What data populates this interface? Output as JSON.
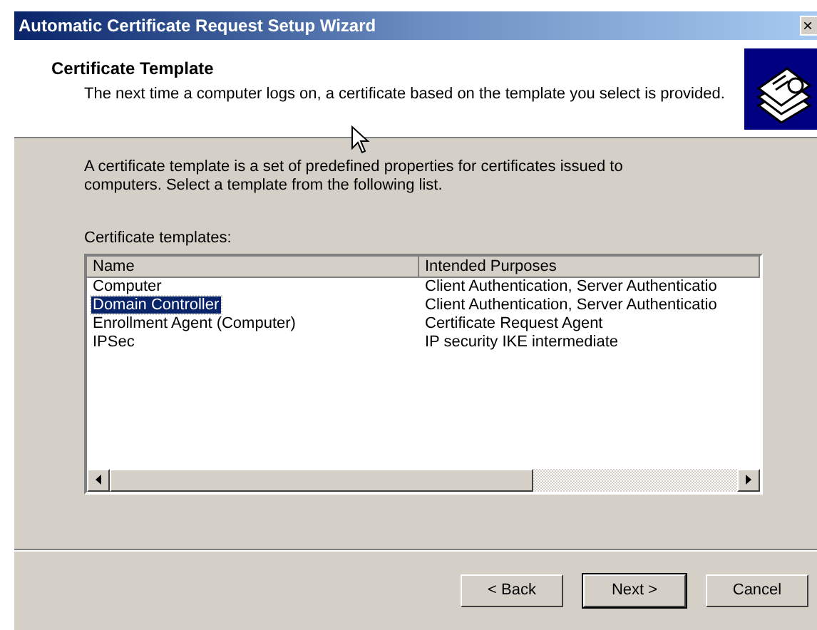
{
  "window": {
    "title": "Automatic Certificate Request Setup Wizard",
    "close": "×"
  },
  "header": {
    "title": "Certificate Template",
    "subtitle": "The next time a computer logs on, a certificate based on the template you select is provided."
  },
  "intro": "A certificate template is a set of predefined properties for certificates issued to computers. Select a template from the following list.",
  "list_label": "Certificate templates:",
  "table": {
    "columns": [
      "Name",
      "Intended Purposes"
    ],
    "rows": [
      {
        "cells": [
          "Computer",
          "Client Authentication, Server Authenticatio"
        ],
        "selected": false
      },
      {
        "cells": [
          "Domain Controller",
          "Client Authentication, Server Authenticatio"
        ],
        "selected": true
      },
      {
        "cells": [
          "Enrollment Agent (Computer)",
          "Certificate Request Agent"
        ],
        "selected": false
      },
      {
        "cells": [
          "IPSec",
          "IP security IKE intermediate"
        ],
        "selected": false
      }
    ]
  },
  "buttons": [
    {
      "label": "< Back",
      "default": false
    },
    {
      "label": "Next >",
      "default": true
    },
    {
      "label": "Cancel",
      "default": false
    }
  ]
}
